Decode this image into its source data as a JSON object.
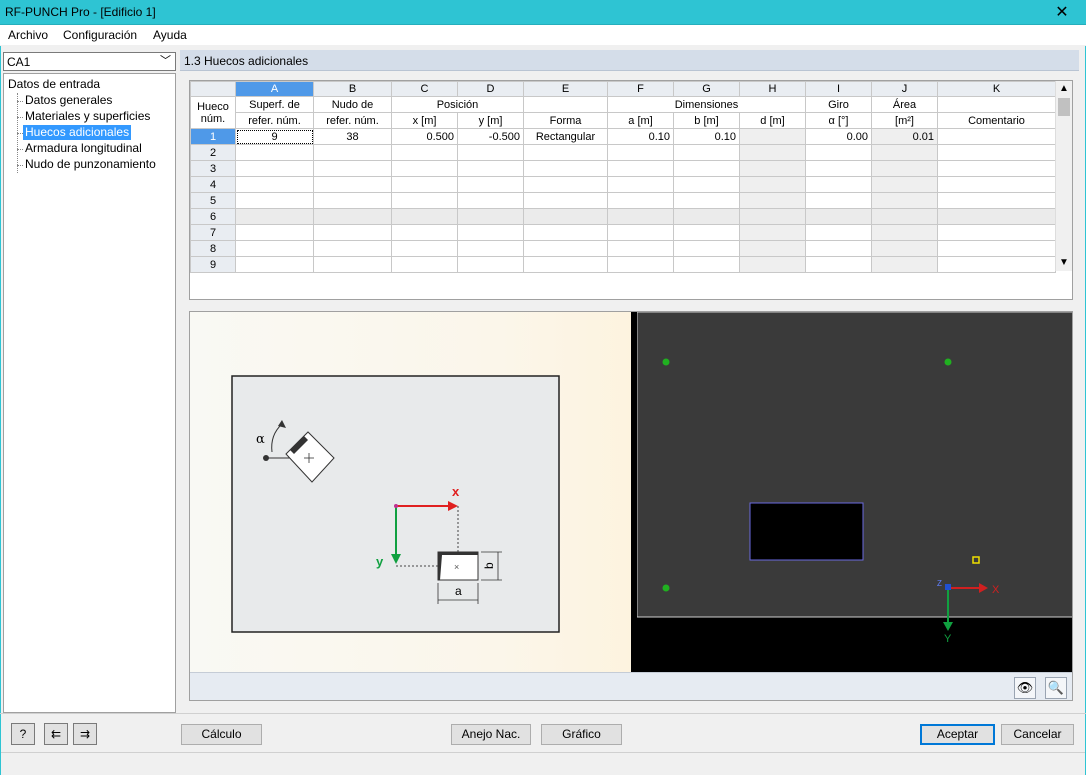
{
  "window": {
    "title": "RF-PUNCH Pro - [Edificio 1]",
    "close_glyph": "✕"
  },
  "menu": [
    "Archivo",
    "Configuración",
    "Ayuda"
  ],
  "case_select": {
    "value": "CA1"
  },
  "tree": {
    "root": "Datos de entrada",
    "items": [
      "Datos generales",
      "Materiales y superficies",
      "Huecos adicionales",
      "Armadura longitudinal",
      "Nudo de punzonamiento"
    ],
    "selected_index": 2
  },
  "panel_title": "1.3 Huecos adicionales",
  "table": {
    "col_letters": [
      "A",
      "B",
      "C",
      "D",
      "E",
      "F",
      "G",
      "H",
      "I",
      "J",
      "K"
    ],
    "header_row_label_1": "Hueco",
    "header_row_label_2": "núm.",
    "header_top": {
      "A": "Superf. de",
      "B": "Nudo de",
      "CD": "Posición",
      "E": "",
      "FGH": "Dimensiones",
      "I": "Giro",
      "J": "Área",
      "K": ""
    },
    "header_bottom": {
      "A": "refer. núm.",
      "B": "refer. núm.",
      "C": "x [m]",
      "D": "y [m]",
      "E": "Forma",
      "F": "a [m]",
      "G": "b [m]",
      "H": "d [m]",
      "I": "α [°]",
      "J": "[m²]",
      "K": "Comentario"
    },
    "rows": [
      {
        "n": "1",
        "A": "9",
        "B": "38",
        "C": "0.500",
        "D": "-0.500",
        "E": "Rectangular",
        "F": "0.10",
        "G": "0.10",
        "H": "",
        "I": "0.00",
        "J": "0.01",
        "K": ""
      },
      {
        "n": "2",
        "A": "",
        "B": "",
        "C": "",
        "D": "",
        "E": "",
        "F": "",
        "G": "",
        "H": "",
        "I": "",
        "J": "",
        "K": ""
      },
      {
        "n": "3",
        "A": "",
        "B": "",
        "C": "",
        "D": "",
        "E": "",
        "F": "",
        "G": "",
        "H": "",
        "I": "",
        "J": "",
        "K": ""
      },
      {
        "n": "4",
        "A": "",
        "B": "",
        "C": "",
        "D": "",
        "E": "",
        "F": "",
        "G": "",
        "H": "",
        "I": "",
        "J": "",
        "K": ""
      },
      {
        "n": "5",
        "A": "",
        "B": "",
        "C": "",
        "D": "",
        "E": "",
        "F": "",
        "G": "",
        "H": "",
        "I": "",
        "J": "",
        "K": ""
      },
      {
        "n": "6",
        "A": "",
        "B": "",
        "C": "",
        "D": "",
        "E": "",
        "F": "",
        "G": "",
        "H": "",
        "I": "",
        "J": "",
        "K": ""
      },
      {
        "n": "7",
        "A": "",
        "B": "",
        "C": "",
        "D": "",
        "E": "",
        "F": "",
        "G": "",
        "H": "",
        "I": "",
        "J": "",
        "K": ""
      },
      {
        "n": "8",
        "A": "",
        "B": "",
        "C": "",
        "D": "",
        "E": "",
        "F": "",
        "G": "",
        "H": "",
        "I": "",
        "J": "",
        "K": ""
      },
      {
        "n": "9",
        "A": "",
        "B": "",
        "C": "",
        "D": "",
        "E": "",
        "F": "",
        "G": "",
        "H": "",
        "I": "",
        "J": "",
        "K": ""
      }
    ]
  },
  "diagram": {
    "alpha": "α",
    "x_axis": "x",
    "y_axis": "y",
    "dim_a": "a",
    "dim_b": "b"
  },
  "view3d": {
    "axis_x": "X",
    "axis_y": "Y",
    "axis_z": "Z"
  },
  "buttons": {
    "calc": "Cálculo",
    "annex": "Anejo Nac.",
    "graphic": "Gráfico",
    "ok": "Aceptar",
    "cancel": "Cancelar"
  },
  "colors": {
    "titlebar": "#2ec4d3",
    "selection": "#3399ff",
    "axis_x": "#e02020",
    "axis_y": "#10a040",
    "node": "#20b020"
  }
}
